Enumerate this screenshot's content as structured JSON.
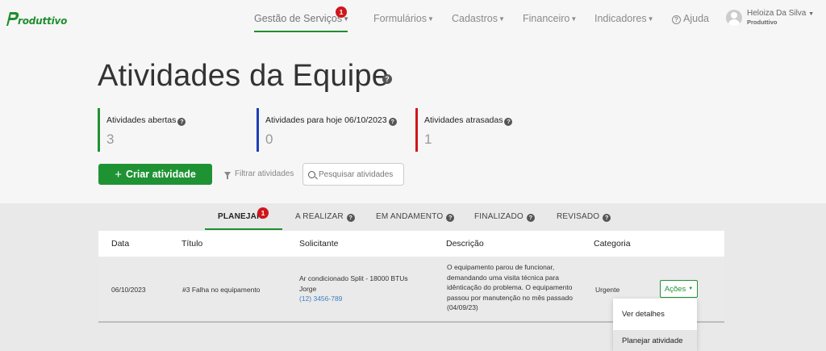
{
  "brand": {
    "name": "roduttivo",
    "color": "#1e8f2e"
  },
  "nav": {
    "items": [
      {
        "label": "Gestão de Serviços",
        "badge": "1",
        "active": true
      },
      {
        "label": "Formulários"
      },
      {
        "label": "Cadastros"
      },
      {
        "label": "Financeiro"
      },
      {
        "label": "Indicadores"
      }
    ],
    "help_label": "Ajuda",
    "user": {
      "name": "Heloiza Da Silva",
      "company": "Produttivo"
    }
  },
  "page": {
    "title": "Atividades da Equipe"
  },
  "stats": [
    {
      "label": "Atividades abertas",
      "value": "3",
      "color": "#1f9334"
    },
    {
      "label": "Atividades para hoje 06/10/2023",
      "value": "0",
      "color": "#1d3fb8"
    },
    {
      "label": "Atividades atrasadas",
      "value": "1",
      "color": "#d0161b"
    }
  ],
  "actions": {
    "create_label": "Criar atividade",
    "filter_label": "Filtrar atividades",
    "search_placeholder": "Pesquisar atividades"
  },
  "tabs": [
    {
      "label": "PLANEJAR",
      "badge": "1",
      "active": true
    },
    {
      "label": "A REALIZAR"
    },
    {
      "label": "EM ANDAMENTO"
    },
    {
      "label": "FINALIZADO"
    },
    {
      "label": "REVISADO"
    }
  ],
  "table": {
    "headers": [
      "Data",
      "Título",
      "Solicitante",
      "Descrição",
      "Categoria"
    ],
    "rows": [
      {
        "data": "06/10/2023",
        "titulo": "#3 Falha no equipamento",
        "solicitante_linha1": "Ar condicionado Split - 18000 BTUs",
        "solicitante_linha2": "Jorge",
        "solicitante_telefone": "(12) 3456-789",
        "descricao": [
          "O equipamento parou de funcionar,",
          "demandando uma visita técnica para",
          "idênticação do problema. O equipamento",
          "passou por manutenção no mês passado",
          "(04/09/23)"
        ],
        "categoria": "Urgente",
        "acoes_label": "Ações"
      }
    ]
  },
  "dropdown": {
    "items": [
      "Ver detalhes",
      "Planejar atividade"
    ]
  }
}
